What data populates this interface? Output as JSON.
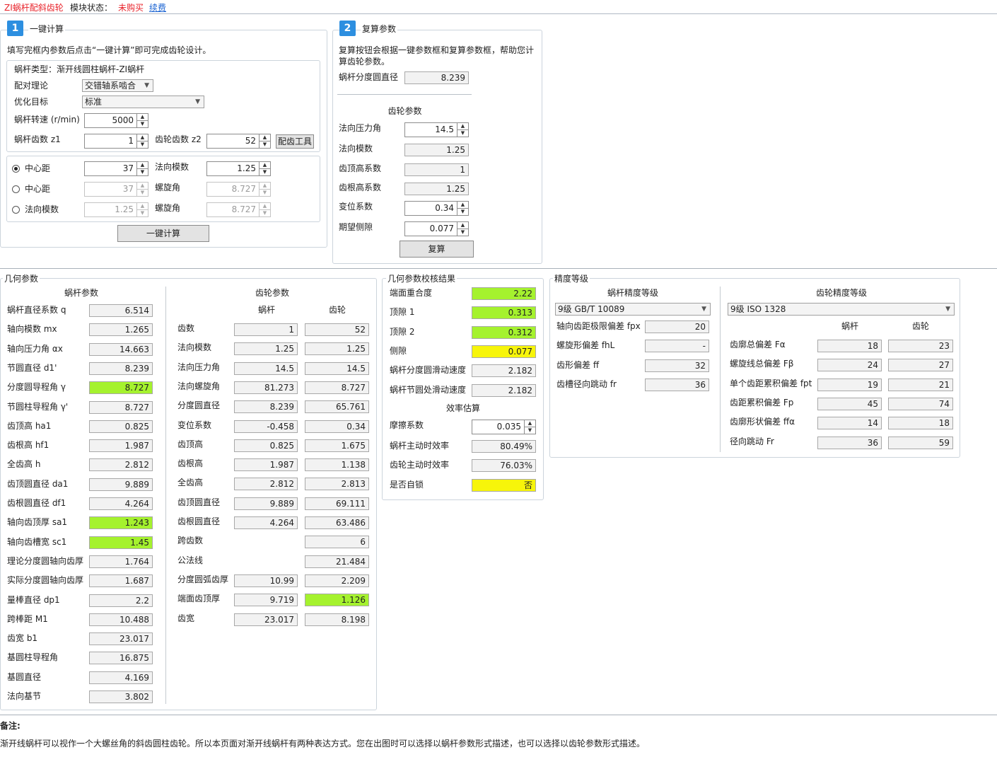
{
  "header": {
    "app_name": "ZI蜗杆配斜齿轮",
    "status_label": "模块状态：",
    "status_value": "未购买",
    "renew": "续费"
  },
  "section1": {
    "badge": "1",
    "title": "一键计算",
    "desc": "填写完框内参数后点击“一键计算”即可完成齿轮设计。",
    "worm_type": "蜗杆类型：渐开线圆柱蜗杆-ZI蜗杆",
    "pair_theory": {
      "label": "配对理论",
      "value": "交错轴系啮合"
    },
    "opt_target": {
      "label": "优化目标",
      "value": "标准"
    },
    "speed": {
      "label": "蜗杆转速 (r/min)",
      "value": "5000"
    },
    "z1": {
      "label": "蜗杆齿数 z1",
      "value": "1"
    },
    "z2": {
      "label": "齿轮齿数 z2",
      "value": "52"
    },
    "tooth_tool": "配齿工具",
    "options": [
      {
        "label": "中心距",
        "value": "37",
        "p_label": "法向模数",
        "p_value": "1.25",
        "selected": true
      },
      {
        "label": "中心距",
        "value": "37",
        "p_label": "螺旋角",
        "p_value": "8.727",
        "selected": false
      },
      {
        "label": "法向模数",
        "value": "1.25",
        "p_label": "螺旋角",
        "p_value": "8.727",
        "selected": false
      }
    ],
    "calc_button": "一键计算"
  },
  "section2": {
    "badge": "2",
    "title": "复算参数",
    "desc1": "复算按钮会根据一键参数框和复算参数框，帮助您计",
    "desc2": "算齿轮参数。",
    "worm_pitch": {
      "label": "蜗杆分度圆直径",
      "value": "8.239"
    },
    "gear_params_title": "齿轮参数",
    "rows": [
      {
        "label": "法向压力角",
        "value": "14.5",
        "spin": true
      },
      {
        "label": "法向模数",
        "value": "1.25",
        "spin": false
      },
      {
        "label": "齿顶高系数",
        "value": "1",
        "spin": false
      },
      {
        "label": "齿根高系数",
        "value": "1.25",
        "spin": false
      },
      {
        "label": "变位系数",
        "value": "0.34",
        "spin": true
      },
      {
        "label": "期望侧隙",
        "value": "0.077",
        "spin": true
      }
    ],
    "recalc_button": "复算"
  },
  "geometry": {
    "title": "几何参数",
    "worm_title": "蜗杆参数",
    "gear_title": "齿轮参数",
    "col_worm": "蜗杆",
    "col_gear": "齿轮",
    "worm_rows": [
      {
        "label": "蜗杆直径系数 q",
        "value": "6.514",
        "hl": ""
      },
      {
        "label": "轴向模数 mx",
        "value": "1.265",
        "hl": ""
      },
      {
        "label": "轴向压力角 αx",
        "value": "14.663",
        "hl": ""
      },
      {
        "label": "节圆直径 d1'",
        "value": "8.239",
        "hl": ""
      },
      {
        "label": "分度圆导程角 γ",
        "value": "8.727",
        "hl": "g"
      },
      {
        "label": "节圆柱导程角 γ'",
        "value": "8.727",
        "hl": ""
      },
      {
        "label": "齿顶高 ha1",
        "value": "0.825",
        "hl": ""
      },
      {
        "label": "齿根高 hf1",
        "value": "1.987",
        "hl": ""
      },
      {
        "label": "全齿高 h",
        "value": "2.812",
        "hl": ""
      },
      {
        "label": "齿顶圆直径 da1",
        "value": "9.889",
        "hl": ""
      },
      {
        "label": "齿根圆直径 df1",
        "value": "4.264",
        "hl": ""
      },
      {
        "label": "轴向齿顶厚 sa1",
        "value": "1.243",
        "hl": "g"
      },
      {
        "label": "轴向齿槽宽 sc1",
        "value": "1.45",
        "hl": "g"
      },
      {
        "label": "理论分度圆轴向齿厚",
        "value": "1.764",
        "hl": ""
      },
      {
        "label": "实际分度圆轴向齿厚",
        "value": "1.687",
        "hl": ""
      },
      {
        "label": "量棒直径 dp1",
        "value": "2.2",
        "hl": ""
      },
      {
        "label": "跨棒距 M1",
        "value": "10.488",
        "hl": ""
      },
      {
        "label": "齿宽 b1",
        "value": "23.017",
        "hl": ""
      },
      {
        "label": "基圆柱导程角",
        "value": "16.875",
        "hl": ""
      },
      {
        "label": "基圆直径",
        "value": "4.169",
        "hl": ""
      },
      {
        "label": "法向基节",
        "value": "3.802",
        "hl": ""
      }
    ],
    "gear_rows": [
      {
        "label": "齿数",
        "worm": "1",
        "gear": "52",
        "hw": "",
        "hg": ""
      },
      {
        "label": "法向模数",
        "worm": "1.25",
        "gear": "1.25",
        "hw": "",
        "hg": ""
      },
      {
        "label": "法向压力角",
        "worm": "14.5",
        "gear": "14.5",
        "hw": "",
        "hg": ""
      },
      {
        "label": "法向螺旋角",
        "worm": "81.273",
        "gear": "8.727",
        "hw": "",
        "hg": ""
      },
      {
        "label": "分度圆直径",
        "worm": "8.239",
        "gear": "65.761",
        "hw": "",
        "hg": ""
      },
      {
        "label": "变位系数",
        "worm": "-0.458",
        "gear": "0.34",
        "hw": "",
        "hg": ""
      },
      {
        "label": "齿顶高",
        "worm": "0.825",
        "gear": "1.675",
        "hw": "",
        "hg": ""
      },
      {
        "label": "齿根高",
        "worm": "1.987",
        "gear": "1.138",
        "hw": "",
        "hg": ""
      },
      {
        "label": "全齿高",
        "worm": "2.812",
        "gear": "2.813",
        "hw": "",
        "hg": ""
      },
      {
        "label": "齿顶圆直径",
        "worm": "9.889",
        "gear": "69.111",
        "hw": "",
        "hg": ""
      },
      {
        "label": "齿根圆直径",
        "worm": "4.264",
        "gear": "63.486",
        "hw": "",
        "hg": ""
      },
      {
        "label": "跨齿数",
        "worm": null,
        "gear": "6",
        "hw": "",
        "hg": ""
      },
      {
        "label": "公法线",
        "worm": null,
        "gear": "21.484",
        "hw": "",
        "hg": ""
      },
      {
        "label": "分度圆弧齿厚",
        "worm": "10.99",
        "gear": "2.209",
        "hw": "",
        "hg": ""
      },
      {
        "label": "端面齿顶厚",
        "worm": "9.719",
        "gear": "1.126",
        "hw": "",
        "hg": "g"
      },
      {
        "label": "齿宽",
        "worm": "23.017",
        "gear": "8.198",
        "hw": "",
        "hg": ""
      }
    ]
  },
  "check": {
    "title": "几何参数校核结果",
    "rows": [
      {
        "label": "端面重合度",
        "value": "2.22",
        "hl": "g"
      },
      {
        "label": "顶隙 1",
        "value": "0.313",
        "hl": "g"
      },
      {
        "label": "顶隙 2",
        "value": "0.312",
        "hl": "g"
      },
      {
        "label": "侧隙",
        "value": "0.077",
        "hl": "y"
      },
      {
        "label": "蜗杆分度圆滑动速度",
        "value": "2.182",
        "hl": ""
      },
      {
        "label": "蜗杆节圆处滑动速度",
        "value": "2.182",
        "hl": ""
      }
    ],
    "eff_title": "效率估算",
    "friction": {
      "label": "摩擦系数",
      "value": "0.035"
    },
    "eff_rows": [
      {
        "label": "蜗杆主动时效率",
        "value": "80.49%",
        "hl": ""
      },
      {
        "label": "齿轮主动时效率",
        "value": "76.03%",
        "hl": ""
      },
      {
        "label": "是否自锁",
        "value": "否",
        "hl": "y"
      }
    ]
  },
  "precision": {
    "title": "精度等级",
    "worm_title": "蜗杆精度等级",
    "gear_title": "齿轮精度等级",
    "worm_select": "9级 GB/T 10089",
    "gear_select": "9级 ISO 1328",
    "col_worm": "蜗杆",
    "col_gear": "齿轮",
    "worm_rows": [
      {
        "label": "轴向齿距极限偏差 fpx",
        "value": "20"
      },
      {
        "label": "螺旋形偏差 fhL",
        "value": "-"
      },
      {
        "label": "齿形偏差 ff",
        "value": "32"
      },
      {
        "label": "齿槽径向跳动 fr",
        "value": "36"
      }
    ],
    "gear_rows": [
      {
        "label": "齿廓总偏差 Fα",
        "worm": "18",
        "gear": "23"
      },
      {
        "label": "螺旋线总偏差 Fβ",
        "worm": "24",
        "gear": "27"
      },
      {
        "label": "单个齿距累积偏差 fpt",
        "worm": "19",
        "gear": "21"
      },
      {
        "label": "齿距累积偏差 Fp",
        "worm": "45",
        "gear": "74"
      },
      {
        "label": "齿廓形状偏差 ffα",
        "worm": "14",
        "gear": "18"
      },
      {
        "label": "径向跳动 Fr",
        "worm": "36",
        "gear": "59"
      }
    ]
  },
  "notes": {
    "title": "备注:",
    "text": "渐开线蜗杆可以视作一个大螺丝角的斜齿圆柱齿轮。所以本页面对渐开线蜗杆有两种表达方式。您在出图时可以选择以蜗杆参数形式描述，也可以选择以齿轮参数形式描述。"
  }
}
